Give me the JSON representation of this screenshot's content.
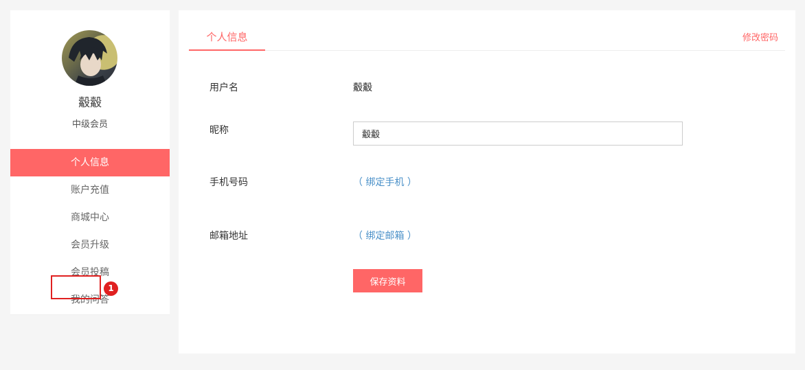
{
  "profile": {
    "username": "觳觳",
    "level": "中级会员"
  },
  "menu": [
    {
      "label": "个人信息",
      "active": true
    },
    {
      "label": "账户充值",
      "active": false
    },
    {
      "label": "商城中心",
      "active": false
    },
    {
      "label": "会员升级",
      "active": false
    },
    {
      "label": "会员投稿",
      "active": false
    },
    {
      "label": "我的问答",
      "active": false
    }
  ],
  "annotation": {
    "badge": "1"
  },
  "main": {
    "tab": "个人信息",
    "change_password": "修改密码",
    "fields": {
      "username_label": "用户名",
      "username_value": "觳觳",
      "nickname_label": "昵称",
      "nickname_value": "觳觳",
      "phone_label": "手机号码",
      "phone_link": "（ 绑定手机 ）",
      "email_label": "邮箱地址",
      "email_link": "（ 绑定邮箱 ）"
    },
    "save_label": "保存资料"
  },
  "colors": {
    "accent": "#ff6666",
    "link": "#4a90c8",
    "annotation": "#e02020"
  }
}
